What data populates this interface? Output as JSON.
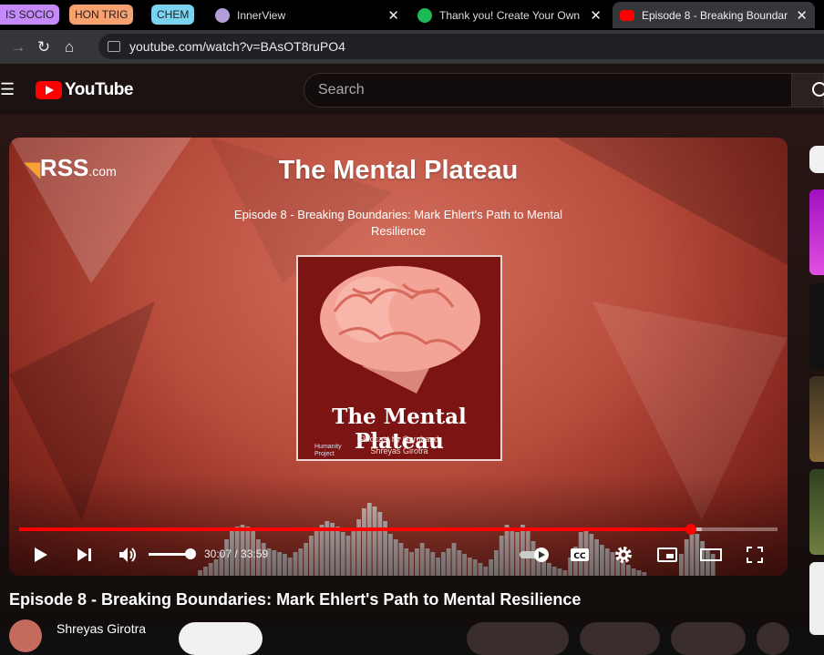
{
  "browser": {
    "bookmarks": [
      {
        "label": "IS SOCIO",
        "color": "#c58af9"
      },
      {
        "label": "HON TRIG",
        "color": "#f7a070"
      },
      {
        "label": "CHEM",
        "color": "#7ad3f0"
      }
    ],
    "tabs": [
      {
        "title": "InnerView",
        "icon_color": "#b39ddb",
        "active": false
      },
      {
        "title": "Thank you! Create Your Own",
        "icon_color": "#1db954",
        "active": false
      },
      {
        "title": "Episode 8 - Breaking Boundar",
        "icon_color": "#ff0000",
        "active": true
      }
    ],
    "url": "youtube.com/watch?v=BAsOT8ruPO4"
  },
  "youtube": {
    "logo_text": "YouTube",
    "search_placeholder": "Search"
  },
  "player": {
    "rss_brand": "RSS",
    "rss_suffix": ".com",
    "show_title": "The Mental Plateau",
    "episode_subtitle": "Episode 8 - Breaking Boundaries: Mark Ehlert's Path to Mental Resilience",
    "cover_title": "The Mental Plateau",
    "cover_sub_1": "Podcast by Gargi and",
    "cover_sub_2": "Shreyas Girotra",
    "cover_logo_1": "Humanity",
    "cover_logo_2": "Project",
    "current_time": "30:07",
    "duration": "33:59",
    "time_display": "30:07 / 33:59",
    "progress": 0.8862,
    "buffered": 0.9,
    "volume": 1.0,
    "accent": "#ff0000"
  },
  "video": {
    "title": "Episode 8 - Breaking Boundaries: Mark Ehlert's Path to Mental Resilience",
    "channel": "Shreyas Girotra"
  }
}
